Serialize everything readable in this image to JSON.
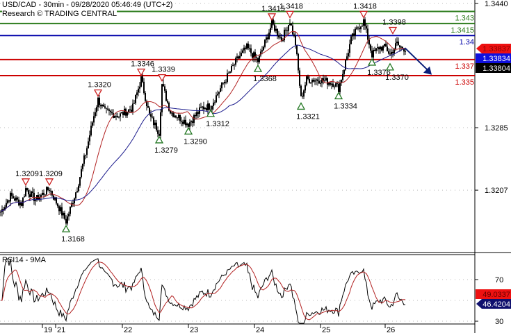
{
  "header": {
    "title": "USD/CAD - 30min - 09/28/2020 05:46:49 (UTC+2)",
    "credit": "Research © TRADING CENTRAL"
  },
  "colors": {
    "support": "#cc0000",
    "resistance": "#2e7d1e",
    "pivot": "#0000aa",
    "ma_fast": "#b22222",
    "ma_slow": "#1a1a8c",
    "arrow": "#0a1f7a"
  },
  "chart_data": [
    {
      "type": "candlestick",
      "title": "USD/CAD - 30min",
      "x_unit": "bar index (30min)",
      "ylim": [
        1.311,
        1.3445
      ],
      "y_ticks": [
        "1.3440",
        "1.3285",
        "1.3207"
      ],
      "x_ticks": [
        {
          "label": "19",
          "bar": 30
        },
        {
          "label": "21",
          "bar": 39.5
        },
        {
          "label": "22",
          "bar": 87.5
        },
        {
          "label": "23",
          "bar": 135
        },
        {
          "label": "24",
          "bar": 182.5
        },
        {
          "label": "25",
          "bar": 230
        },
        {
          "label": "26",
          "bar": 276.5
        }
      ],
      "price_anchors": [
        [
          0,
          1.318
        ],
        [
          7,
          1.32
        ],
        [
          15,
          1.319
        ],
        [
          18,
          1.3209
        ],
        [
          25,
          1.3195
        ],
        [
          35,
          1.3209
        ],
        [
          42,
          1.3185
        ],
        [
          47,
          1.3168
        ],
        [
          55,
          1.321
        ],
        [
          62,
          1.326
        ],
        [
          67,
          1.33
        ],
        [
          70,
          1.332
        ],
        [
          75,
          1.3305
        ],
        [
          85,
          1.33
        ],
        [
          95,
          1.331
        ],
        [
          101,
          1.3346
        ],
        [
          107,
          1.33
        ],
        [
          114,
          1.3279
        ],
        [
          116,
          1.3339
        ],
        [
          122,
          1.3305
        ],
        [
          135,
          1.329
        ],
        [
          145,
          1.331
        ],
        [
          151,
          1.3312
        ],
        [
          160,
          1.334
        ],
        [
          170,
          1.337
        ],
        [
          177,
          1.3385
        ],
        [
          185,
          1.3368
        ],
        [
          192,
          1.34
        ],
        [
          195,
          1.3415
        ],
        [
          202,
          1.3395
        ],
        [
          208,
          1.3418
        ],
        [
          212,
          1.339
        ],
        [
          216,
          1.3321
        ],
        [
          220,
          1.3345
        ],
        [
          230,
          1.3345
        ],
        [
          240,
          1.334
        ],
        [
          243,
          1.3334
        ],
        [
          247,
          1.336
        ],
        [
          252,
          1.3395
        ],
        [
          257,
          1.341
        ],
        [
          261,
          1.3418
        ],
        [
          265,
          1.339
        ],
        [
          267,
          1.3376
        ],
        [
          272,
          1.3385
        ],
        [
          277,
          1.3385
        ],
        [
          280,
          1.3376
        ],
        [
          285,
          1.339
        ],
        [
          287,
          1.3385
        ],
        [
          291,
          1.3384
        ]
      ],
      "levels": [
        {
          "label": "1.343",
          "price": 1.343,
          "kind": "resistance"
        },
        {
          "label": "1.3415",
          "price": 1.3415,
          "kind": "resistance"
        },
        {
          "label": "1.34",
          "price": 1.34,
          "kind": "pivot"
        },
        {
          "label": "1.337",
          "price": 1.337,
          "kind": "support"
        },
        {
          "label": "1.335",
          "price": 1.335,
          "kind": "support"
        }
      ],
      "markers": [
        {
          "label": "1.3209",
          "price": 1.3209,
          "bar": 18,
          "type": "high"
        },
        {
          "label": "1.3209",
          "price": 1.3209,
          "bar": 35,
          "type": "high"
        },
        {
          "label": "1.3168",
          "price": 1.3168,
          "bar": 47,
          "type": "low"
        },
        {
          "label": "1.3320",
          "price": 1.332,
          "bar": 70,
          "type": "high"
        },
        {
          "label": "1.3346",
          "price": 1.3346,
          "bar": 101,
          "type": "high"
        },
        {
          "label": "1.3279",
          "price": 1.3279,
          "bar": 114,
          "type": "low"
        },
        {
          "label": "1.3339",
          "price": 1.3339,
          "bar": 116,
          "type": "high"
        },
        {
          "label": "1.3290",
          "price": 1.329,
          "bar": 135,
          "type": "low"
        },
        {
          "label": "1.3312",
          "price": 1.3312,
          "bar": 151,
          "type": "low"
        },
        {
          "label": "1.3368",
          "price": 1.3368,
          "bar": 185,
          "type": "low"
        },
        {
          "label": "1.3415",
          "price": 1.3415,
          "bar": 195,
          "type": "high"
        },
        {
          "label": "1.3418",
          "price": 1.3418,
          "bar": 208,
          "type": "high"
        },
        {
          "label": "1.3321",
          "price": 1.3321,
          "bar": 216,
          "type": "low"
        },
        {
          "label": "1.3334",
          "price": 1.3334,
          "bar": 243,
          "type": "low"
        },
        {
          "label": "1.3418",
          "price": 1.3418,
          "bar": 261,
          "type": "high"
        },
        {
          "label": "1.3398",
          "price": 1.3398,
          "bar": 282,
          "type": "high"
        },
        {
          "label": "1.3376",
          "price": 1.3376,
          "bar": 267,
          "type": "low"
        },
        {
          "label": "1.3370",
          "price": 1.337,
          "bar": 280,
          "type": "low"
        }
      ],
      "price_tags": [
        {
          "label": "1.33837",
          "color": "#ee1111"
        },
        {
          "label": "1.33834",
          "color": "#1010dd"
        },
        {
          "label": "1.33804",
          "color": "#000000"
        }
      ],
      "forecast_arrow": {
        "from": [
          291,
          1.3384
        ],
        "to": [
          310,
          1.3351
        ]
      }
    },
    {
      "type": "line",
      "title": "RSI14 - 9MA",
      "ylim": [
        28,
        92
      ],
      "y_ticks": [
        "70",
        "30"
      ],
      "series": [
        {
          "name": "RSI14",
          "color": "#000000"
        },
        {
          "name": "9MA",
          "color": "#b22222"
        }
      ],
      "tags": [
        {
          "label": "49.0337",
          "color": "#ee1111"
        },
        {
          "label": "46.4204",
          "color": "#10106e"
        }
      ]
    }
  ]
}
